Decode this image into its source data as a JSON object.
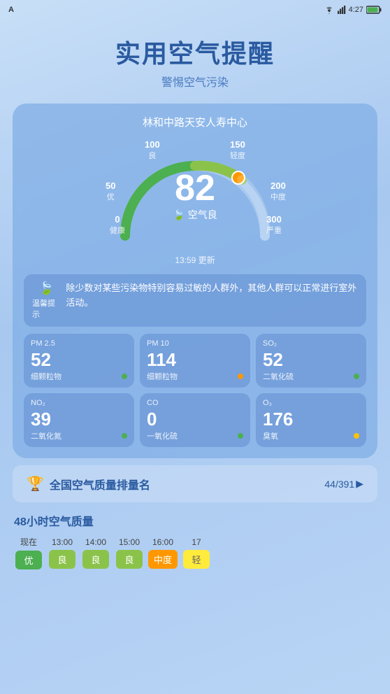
{
  "statusBar": {
    "appName": "A",
    "time": "4:27",
    "wifiIcon": "wifi",
    "batteryIcon": "battery"
  },
  "header": {
    "title": "实用空气提醒",
    "subtitle": "警惕空气污染"
  },
  "card": {
    "location": "林和中路天安人寿中心",
    "gaugeValue": "82",
    "gaugeQuality": "空气良",
    "updateTime": "13:59 更新",
    "labels": {
      "l0": "0",
      "l0txt": "健康",
      "l50": "50",
      "l50txt": "优",
      "l100": "100",
      "l100txt": "良",
      "l150": "150",
      "l150txt": "轻度",
      "l200": "200",
      "l200txt": "中度",
      "l300": "300",
      "l300txt": "严重"
    },
    "warning": {
      "icon": "🍃",
      "tag": "温馨提示",
      "text": "除少数对某些污染物特别容易过敏的人群外，其他人群可以正常进行室外活动。"
    },
    "metrics": [
      {
        "name": "PM 2.5",
        "value": "52",
        "label": "细颗粒物",
        "dot": "green"
      },
      {
        "name": "PM 10",
        "value": "114",
        "label": "细颗粒物",
        "dot": "orange"
      },
      {
        "name": "SO₂",
        "value": "52",
        "label": "二氧化硫",
        "dot": "green"
      },
      {
        "name": "NO₂",
        "value": "39",
        "label": "二氧化氮",
        "dot": "green"
      },
      {
        "name": "CO",
        "value": "0",
        "label": "一氧化硫",
        "dot": "green"
      },
      {
        "name": "O₃",
        "value": "176",
        "label": "臭氧",
        "dot": "yellow"
      }
    ]
  },
  "ranking": {
    "icon": "🏆",
    "text": "全国空气质量排量名",
    "value": "44/391",
    "arrow": "▶"
  },
  "quality48h": {
    "title": "48小时空气质量",
    "columns": [
      {
        "time": "现在",
        "badge": "优",
        "type": "excellent"
      },
      {
        "time": "13:00",
        "badge": "良",
        "type": "good"
      },
      {
        "time": "14:00",
        "badge": "良",
        "type": "good"
      },
      {
        "time": "15:00",
        "badge": "良",
        "type": "good"
      },
      {
        "time": "16:00",
        "badge": "中度",
        "type": "moderate"
      },
      {
        "time": "17",
        "badge": "轻",
        "type": "light"
      }
    ]
  }
}
